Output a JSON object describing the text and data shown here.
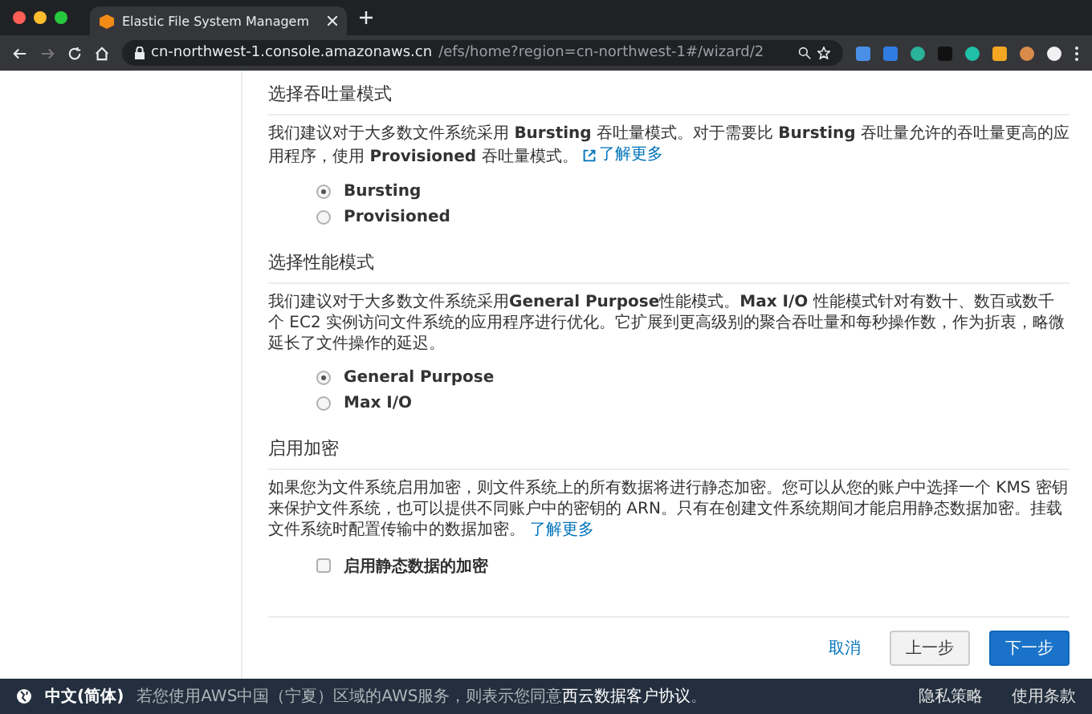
{
  "browser": {
    "tab_title": "Elastic File System Managem",
    "url_host": "cn-northwest-1.console.amazonaws.cn",
    "url_path": "/efs/home?region=cn-northwest-1#/wizard/2"
  },
  "sections": [
    {
      "kind": "radio",
      "title": "选择吞吐量模式",
      "description": "我们建议对于大多数文件系统采用 **Bursting** 吞吐量模式。对于需要比 **Bursting** 吞吐量允许的吞吐量更高的应用程序，使用 **Provisioned** 吞吐量模式。",
      "link": "了解更多",
      "link_icon": true,
      "options": [
        {
          "label": "Bursting",
          "selected": true
        },
        {
          "label": "Provisioned",
          "selected": false
        }
      ]
    },
    {
      "kind": "radio",
      "title": "选择性能模式",
      "description": "我们建议对于大多数文件系统采用**General Purpose**性能模式。**Max I/O** 性能模式针对有数十、数百或数千个 EC2 实例访问文件系统的应用程序进行优化。它扩展到更高级别的聚合吞吐量和每秒操作数，作为折衷，略微延长了文件操作的延迟。",
      "options": [
        {
          "label": "General Purpose",
          "selected": true
        },
        {
          "label": "Max I/O",
          "selected": false
        }
      ]
    },
    {
      "kind": "checkbox",
      "title": "启用加密",
      "description": "如果您为文件系统启用加密，则文件系统上的所有数据将进行静态加密。您可以从您的账户中选择一个 KMS 密钥来保护文件系统，也可以提供不同账户中的密钥的 ARN。只有在创建文件系统期间才能启用静态数据加密。挂载文件系统时配置传输中的数据加密。",
      "link": "了解更多",
      "link_icon": false,
      "options": [
        {
          "label": "启用静态数据的加密",
          "checked": false
        }
      ]
    }
  ],
  "actions": {
    "cancel": "取消",
    "previous": "上一步",
    "next": "下一步"
  },
  "footer": {
    "language": "中文(简体)",
    "notice": "若您使用AWS中国（宁夏）区域的AWS服务，则表示您同意**西云数据客户协议**。",
    "links": [
      "隐私策略",
      "使用条款"
    ]
  }
}
